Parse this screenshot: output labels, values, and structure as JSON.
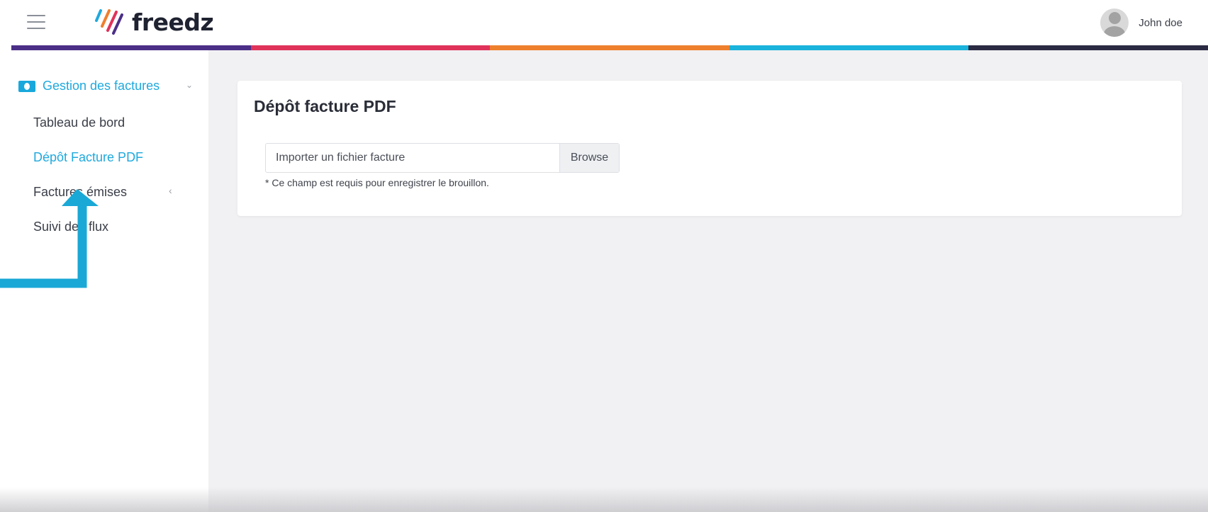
{
  "header": {
    "logo_text": "freedz",
    "user_name": "John doe"
  },
  "colors": {
    "accent": "#1fa9dd",
    "colorbar": [
      "#4b2f87",
      "#e0335a",
      "#ee7f2d",
      "#19b3dc",
      "#2c2b44"
    ]
  },
  "sidebar": {
    "section_label": "Gestion des factures",
    "section_icon": "money-icon",
    "items": [
      {
        "label": "Tableau de bord"
      },
      {
        "label": "Dépôt Facture PDF"
      },
      {
        "label": "Factures émises"
      },
      {
        "label": "Suivi des flux"
      }
    ]
  },
  "main": {
    "title": "Dépôt facture PDF",
    "file_input_text": "Importer un fichier facture",
    "browse_label": "Browse",
    "hint": "* Ce champ est requis pour enregistrer le brouillon."
  }
}
